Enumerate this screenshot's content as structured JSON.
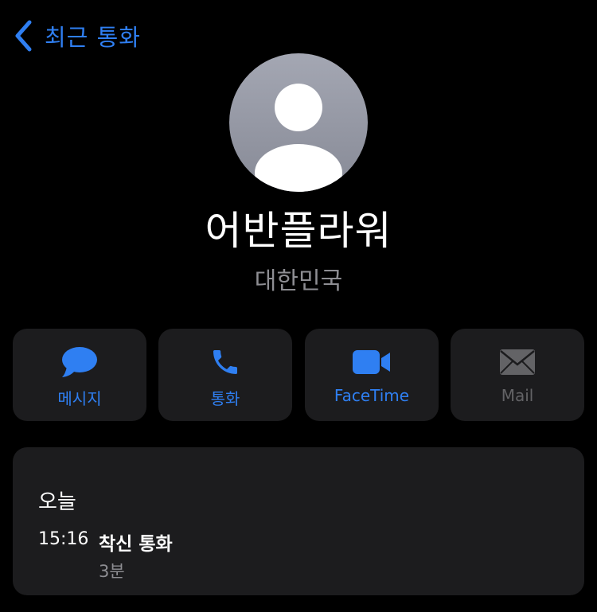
{
  "navigation": {
    "back_label": "최근 통화"
  },
  "contact": {
    "name": "어반플라워",
    "subtitle": "대한민국"
  },
  "actions": [
    {
      "label": "메시지",
      "icon": "message-bubble-icon",
      "enabled": true
    },
    {
      "label": "통화",
      "icon": "phone-icon",
      "enabled": true
    },
    {
      "label": "FaceTime",
      "icon": "video-camera-icon",
      "enabled": true
    },
    {
      "label": "Mail",
      "icon": "envelope-icon",
      "enabled": false
    }
  ],
  "history": {
    "title": "오늘",
    "entries": [
      {
        "time": "15:16",
        "type": "착신 통화",
        "duration": "3분"
      }
    ]
  },
  "colors": {
    "background": "#000000",
    "card": "#1c1c1e",
    "accent": "#2f7ff2",
    "secondary_text": "#8e8e93",
    "disabled": "#636366"
  }
}
